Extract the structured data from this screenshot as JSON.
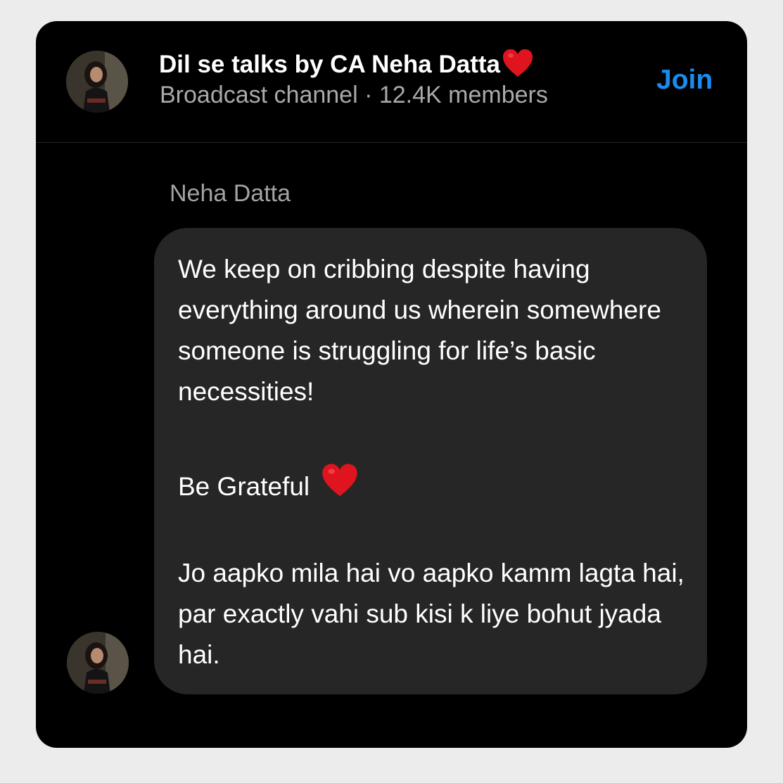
{
  "header": {
    "title": "Dil se talks by CA Neha Datta",
    "title_icon": "red-heart-icon",
    "subtitle": "Broadcast channel · 12.4K members",
    "join_label": "Join"
  },
  "message": {
    "sender": "Neha Datta",
    "paragraphs": [
      "We keep on cribbing despite having everything around us wherein somewhere someone is struggling for life’s basic necessities!",
      "Be Grateful",
      "Jo aapko mila hai vo aapko kamm lagta hai, par exactly vahi sub kisi k liye bohut jyada hai."
    ],
    "paragraph_icon": "red-heart-icon"
  },
  "colors": {
    "background": "#000000",
    "bubble": "#262626",
    "accent": "#1a8cf0",
    "secondary_text": "#a9a9ab",
    "heart": "#e0141e"
  }
}
